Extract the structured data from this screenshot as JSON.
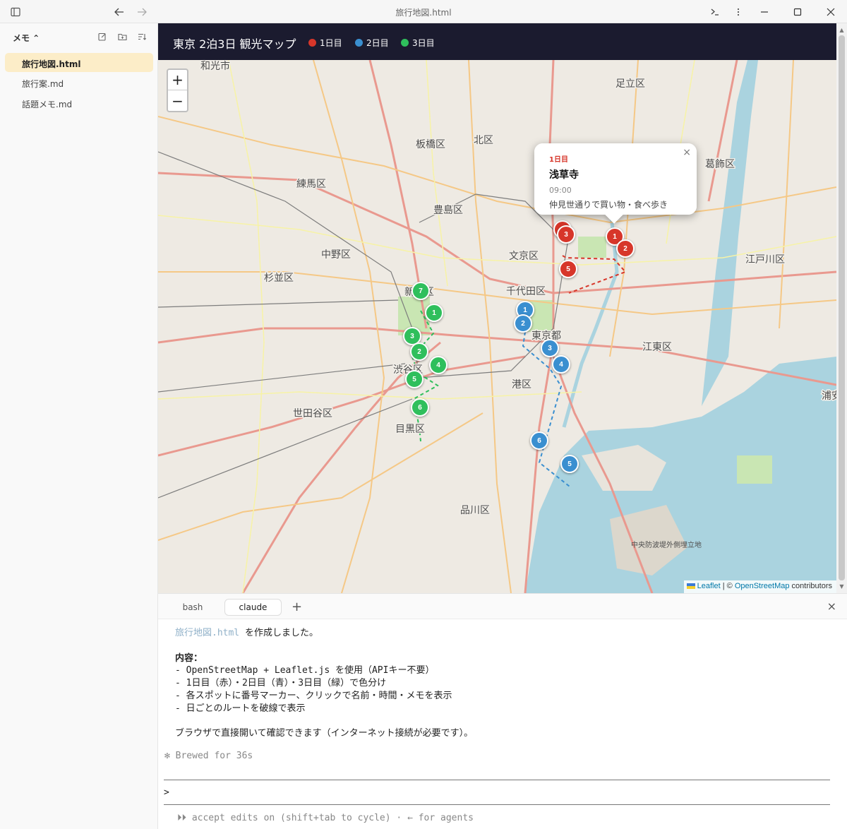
{
  "window": {
    "title": "旅行地図.html",
    "icons": [
      "sidebar-toggle-icon",
      "back-arrow-icon",
      "forward-arrow-icon",
      "terminal-icon",
      "more-icon",
      "minimize-icon",
      "maximize-icon",
      "close-icon"
    ]
  },
  "sidebar": {
    "title": "メモ ⌃",
    "files": [
      {
        "name": "旅行地図.html",
        "active": true
      },
      {
        "name": "旅行案.md",
        "active": false
      },
      {
        "name": "話題メモ.md",
        "active": false
      }
    ]
  },
  "map": {
    "title": "東京 2泊3日 観光マップ",
    "legend": [
      {
        "label": "1日目",
        "color": "#d7362a"
      },
      {
        "label": "2日目",
        "color": "#3a8fd0"
      },
      {
        "label": "3日目",
        "color": "#2fbf5c"
      }
    ],
    "zoom_in": "+",
    "zoom_out": "−",
    "popup": {
      "day": "1日目",
      "name": "浅草寺",
      "time": "09:00",
      "memo": "仲見世通りで買い物・食べ歩き",
      "close": "×"
    },
    "attribution": {
      "leaflet": "Leaflet",
      "sep": " | © ",
      "osm": "OpenStreetMap",
      "contrib": " contributors"
    },
    "place_labels": [
      "和光市",
      "足立区",
      "板橋区",
      "北区",
      "葛飾区",
      "練馬区",
      "豊島区",
      "中野区",
      "文京区",
      "江戸川区",
      "杉並区",
      "千代田区",
      "新宿区",
      "東京都",
      "江東区",
      "渋谷区",
      "港区",
      "世田谷区",
      "目黒区",
      "品川区",
      "中央防波堤外側埋立地",
      "浦安"
    ]
  },
  "terminal": {
    "tabs": [
      "bash",
      "claude"
    ],
    "active_tab": "claude",
    "add": "+",
    "close": "×",
    "lines": {
      "created_file": "旅行地図.html",
      "created_suffix": " を作成しました。",
      "content_heading": "内容：",
      "b1": "- OpenStreetMap + Leaflet.js を使用（APIキー不要）",
      "b2": "- 1日目（赤）・2日目（青）・3日目（緑）で色分け",
      "b3": "- 各スポットに番号マーカー、クリックで名前・時間・メモを表示",
      "b4": "- 日ごとのルートを破線で表示",
      "note": "ブラウザで直接開いて確認できます（インターネット接続が必要です）。",
      "brewed": "✻ Brewed for 36s",
      "prompt": ">",
      "footer": "⏵⏵ accept edits on (shift+tab to cycle) · ← for agents"
    }
  }
}
